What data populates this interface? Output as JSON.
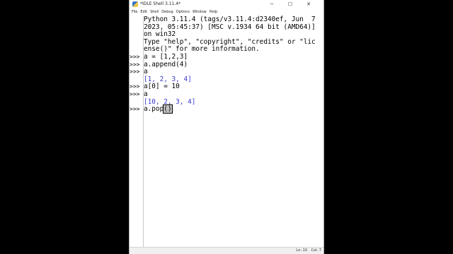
{
  "window": {
    "title": "*IDLE Shell 3.11.4*",
    "controls": {
      "minimize": "─",
      "maximize": "☐",
      "close": "✕"
    }
  },
  "menu": [
    "File",
    "Edit",
    "Shell",
    "Debug",
    "Options",
    "Window",
    "Help"
  ],
  "shell": {
    "banner": [
      "Python 3.11.4 (tags/v3.11.4:d2340ef, Jun  7",
      "2023, 05:45:37) [MSC v.1934 64 bit (AMD64)]",
      "on win32",
      "Type \"help\", \"copyright\", \"credits\" or \"lic",
      "ense()\" for more information."
    ],
    "prompt": ">>>",
    "lines": [
      {
        "kind": "input",
        "text": "a = [1,2,3]"
      },
      {
        "kind": "input",
        "text": "a.append(4)"
      },
      {
        "kind": "input",
        "text": "a"
      },
      {
        "kind": "output",
        "text": "[1, 2, 3, 4]"
      },
      {
        "kind": "input",
        "text": "a[0] = 10"
      },
      {
        "kind": "input",
        "text": "a"
      },
      {
        "kind": "output",
        "text": "[10, 2, 3, 4]"
      }
    ],
    "current_input": {
      "before": "a.pop",
      "highlighted": "()"
    }
  },
  "status": {
    "line": "Ln: 10",
    "col": "Col: 7"
  },
  "colors": {
    "output": "#3a3ad0",
    "background": "#ffffff",
    "letterbox": "#000000"
  }
}
